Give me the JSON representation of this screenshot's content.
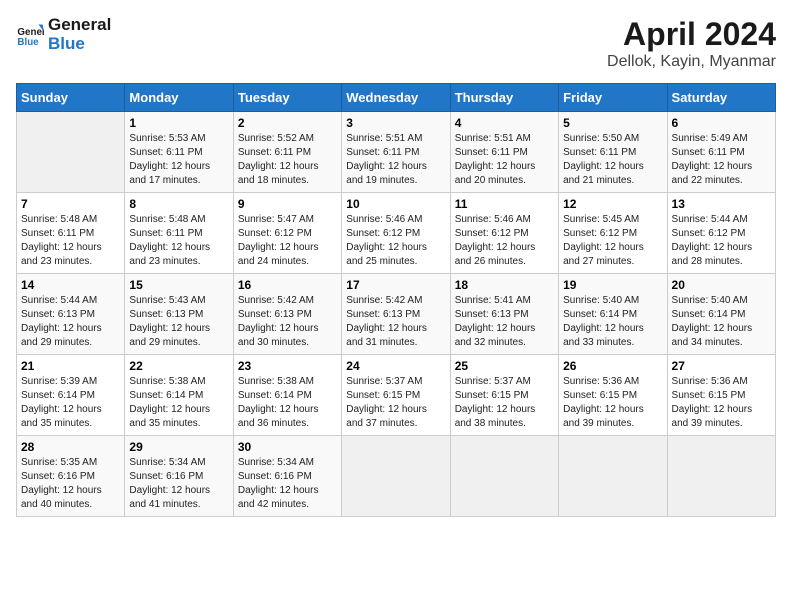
{
  "logo": {
    "line1": "General",
    "line2": "Blue"
  },
  "title": "April 2024",
  "subtitle": "Dellok, Kayin, Myanmar",
  "days_of_week": [
    "Sunday",
    "Monday",
    "Tuesday",
    "Wednesday",
    "Thursday",
    "Friday",
    "Saturday"
  ],
  "weeks": [
    [
      {
        "day": "",
        "sunrise": "",
        "sunset": "",
        "daylight": ""
      },
      {
        "day": "1",
        "sunrise": "Sunrise: 5:53 AM",
        "sunset": "Sunset: 6:11 PM",
        "daylight": "Daylight: 12 hours and 17 minutes."
      },
      {
        "day": "2",
        "sunrise": "Sunrise: 5:52 AM",
        "sunset": "Sunset: 6:11 PM",
        "daylight": "Daylight: 12 hours and 18 minutes."
      },
      {
        "day": "3",
        "sunrise": "Sunrise: 5:51 AM",
        "sunset": "Sunset: 6:11 PM",
        "daylight": "Daylight: 12 hours and 19 minutes."
      },
      {
        "day": "4",
        "sunrise": "Sunrise: 5:51 AM",
        "sunset": "Sunset: 6:11 PM",
        "daylight": "Daylight: 12 hours and 20 minutes."
      },
      {
        "day": "5",
        "sunrise": "Sunrise: 5:50 AM",
        "sunset": "Sunset: 6:11 PM",
        "daylight": "Daylight: 12 hours and 21 minutes."
      },
      {
        "day": "6",
        "sunrise": "Sunrise: 5:49 AM",
        "sunset": "Sunset: 6:11 PM",
        "daylight": "Daylight: 12 hours and 22 minutes."
      }
    ],
    [
      {
        "day": "7",
        "sunrise": "Sunrise: 5:48 AM",
        "sunset": "Sunset: 6:11 PM",
        "daylight": "Daylight: 12 hours and 23 minutes."
      },
      {
        "day": "8",
        "sunrise": "Sunrise: 5:48 AM",
        "sunset": "Sunset: 6:11 PM",
        "daylight": "Daylight: 12 hours and 23 minutes."
      },
      {
        "day": "9",
        "sunrise": "Sunrise: 5:47 AM",
        "sunset": "Sunset: 6:12 PM",
        "daylight": "Daylight: 12 hours and 24 minutes."
      },
      {
        "day": "10",
        "sunrise": "Sunrise: 5:46 AM",
        "sunset": "Sunset: 6:12 PM",
        "daylight": "Daylight: 12 hours and 25 minutes."
      },
      {
        "day": "11",
        "sunrise": "Sunrise: 5:46 AM",
        "sunset": "Sunset: 6:12 PM",
        "daylight": "Daylight: 12 hours and 26 minutes."
      },
      {
        "day": "12",
        "sunrise": "Sunrise: 5:45 AM",
        "sunset": "Sunset: 6:12 PM",
        "daylight": "Daylight: 12 hours and 27 minutes."
      },
      {
        "day": "13",
        "sunrise": "Sunrise: 5:44 AM",
        "sunset": "Sunset: 6:12 PM",
        "daylight": "Daylight: 12 hours and 28 minutes."
      }
    ],
    [
      {
        "day": "14",
        "sunrise": "Sunrise: 5:44 AM",
        "sunset": "Sunset: 6:13 PM",
        "daylight": "Daylight: 12 hours and 29 minutes."
      },
      {
        "day": "15",
        "sunrise": "Sunrise: 5:43 AM",
        "sunset": "Sunset: 6:13 PM",
        "daylight": "Daylight: 12 hours and 29 minutes."
      },
      {
        "day": "16",
        "sunrise": "Sunrise: 5:42 AM",
        "sunset": "Sunset: 6:13 PM",
        "daylight": "Daylight: 12 hours and 30 minutes."
      },
      {
        "day": "17",
        "sunrise": "Sunrise: 5:42 AM",
        "sunset": "Sunset: 6:13 PM",
        "daylight": "Daylight: 12 hours and 31 minutes."
      },
      {
        "day": "18",
        "sunrise": "Sunrise: 5:41 AM",
        "sunset": "Sunset: 6:13 PM",
        "daylight": "Daylight: 12 hours and 32 minutes."
      },
      {
        "day": "19",
        "sunrise": "Sunrise: 5:40 AM",
        "sunset": "Sunset: 6:14 PM",
        "daylight": "Daylight: 12 hours and 33 minutes."
      },
      {
        "day": "20",
        "sunrise": "Sunrise: 5:40 AM",
        "sunset": "Sunset: 6:14 PM",
        "daylight": "Daylight: 12 hours and 34 minutes."
      }
    ],
    [
      {
        "day": "21",
        "sunrise": "Sunrise: 5:39 AM",
        "sunset": "Sunset: 6:14 PM",
        "daylight": "Daylight: 12 hours and 35 minutes."
      },
      {
        "day": "22",
        "sunrise": "Sunrise: 5:38 AM",
        "sunset": "Sunset: 6:14 PM",
        "daylight": "Daylight: 12 hours and 35 minutes."
      },
      {
        "day": "23",
        "sunrise": "Sunrise: 5:38 AM",
        "sunset": "Sunset: 6:14 PM",
        "daylight": "Daylight: 12 hours and 36 minutes."
      },
      {
        "day": "24",
        "sunrise": "Sunrise: 5:37 AM",
        "sunset": "Sunset: 6:15 PM",
        "daylight": "Daylight: 12 hours and 37 minutes."
      },
      {
        "day": "25",
        "sunrise": "Sunrise: 5:37 AM",
        "sunset": "Sunset: 6:15 PM",
        "daylight": "Daylight: 12 hours and 38 minutes."
      },
      {
        "day": "26",
        "sunrise": "Sunrise: 5:36 AM",
        "sunset": "Sunset: 6:15 PM",
        "daylight": "Daylight: 12 hours and 39 minutes."
      },
      {
        "day": "27",
        "sunrise": "Sunrise: 5:36 AM",
        "sunset": "Sunset: 6:15 PM",
        "daylight": "Daylight: 12 hours and 39 minutes."
      }
    ],
    [
      {
        "day": "28",
        "sunrise": "Sunrise: 5:35 AM",
        "sunset": "Sunset: 6:16 PM",
        "daylight": "Daylight: 12 hours and 40 minutes."
      },
      {
        "day": "29",
        "sunrise": "Sunrise: 5:34 AM",
        "sunset": "Sunset: 6:16 PM",
        "daylight": "Daylight: 12 hours and 41 minutes."
      },
      {
        "day": "30",
        "sunrise": "Sunrise: 5:34 AM",
        "sunset": "Sunset: 6:16 PM",
        "daylight": "Daylight: 12 hours and 42 minutes."
      },
      {
        "day": "",
        "sunrise": "",
        "sunset": "",
        "daylight": ""
      },
      {
        "day": "",
        "sunrise": "",
        "sunset": "",
        "daylight": ""
      },
      {
        "day": "",
        "sunrise": "",
        "sunset": "",
        "daylight": ""
      },
      {
        "day": "",
        "sunrise": "",
        "sunset": "",
        "daylight": ""
      }
    ]
  ]
}
